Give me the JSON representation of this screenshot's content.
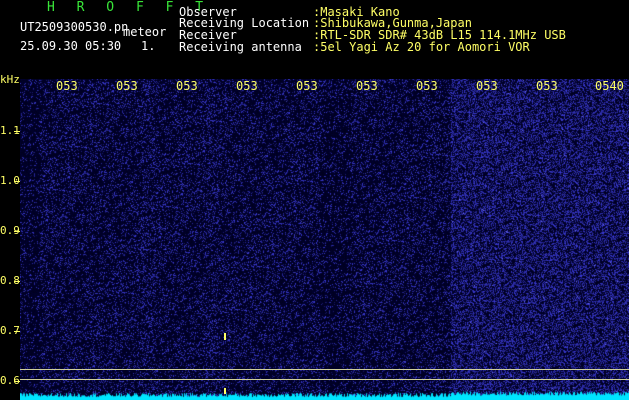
{
  "header": {
    "station": "H R O F F T",
    "filename": "UT2509300530.pn",
    "mode": "meteor",
    "datetime": "25.09.30 05:30",
    "count": "1.",
    "info": [
      {
        "label": "Observer",
        "value": ":Masaki Kano"
      },
      {
        "label": "Receiving Location",
        "value": ":Shibukawa,Gunma,Japan"
      },
      {
        "label": "Receiver",
        "value": ":RTL-SDR SDR# 43dB L15 114.1MHz USB"
      },
      {
        "label": "Receiving antenna",
        "value": ":5el Yagi Az 20 for Aomori VOR"
      }
    ]
  },
  "axes": {
    "y_unit": "kHz",
    "y_ticks": [
      "1.1",
      "1.0",
      "0.9",
      "0.8",
      "0.7",
      "0.6"
    ],
    "x_ticks": [
      "053",
      "053",
      "053",
      "053",
      "053",
      "053",
      "053",
      "053",
      "053",
      "0540"
    ]
  },
  "colors": {
    "background": "#000000",
    "spectrogram": "#0a0a55",
    "noise_dots": "#3a3acc",
    "signal": "#00e5ff",
    "axis_text": "#ffff66",
    "title_text": "#39e639"
  }
}
